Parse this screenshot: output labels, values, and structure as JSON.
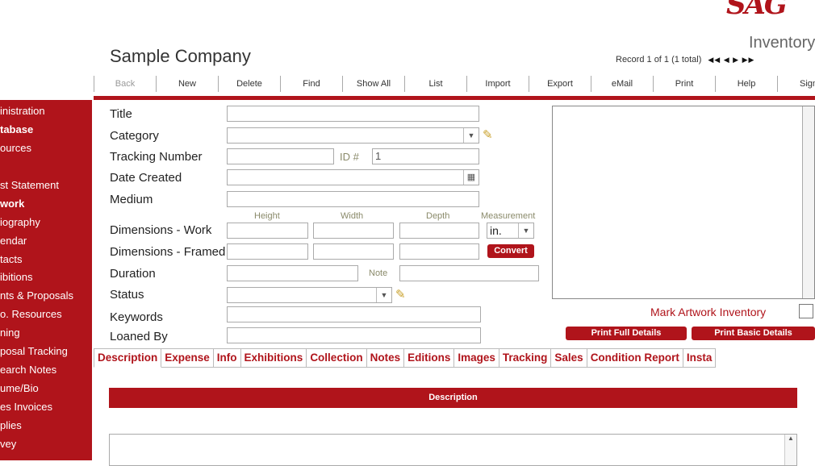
{
  "brand": {
    "logo_text": "SAG"
  },
  "header": {
    "company": "Sample Company",
    "module": "Inventory",
    "record_text": "Record 1 of 1 (1 total)",
    "record_nav": "◀◀ ◀ ▶ ▶▶"
  },
  "toolbar": [
    "Back",
    "New",
    "Delete",
    "Find",
    "Show All",
    "List",
    "Import",
    "Export",
    "eMail",
    "Print",
    "Help",
    "Sign"
  ],
  "sidebar": [
    {
      "label": "inistration",
      "bold": false
    },
    {
      "label": "tabase",
      "bold": true
    },
    {
      "label": "ources",
      "bold": false
    },
    {
      "label": "",
      "bold": false
    },
    {
      "label": "st Statement",
      "bold": false
    },
    {
      "label": "work",
      "bold": true
    },
    {
      "label": "iography",
      "bold": false
    },
    {
      "label": "endar",
      "bold": false
    },
    {
      "label": "tacts",
      "bold": false
    },
    {
      "label": "ibitions",
      "bold": false
    },
    {
      "label": "nts & Proposals",
      "bold": false
    },
    {
      "label": "o. Resources",
      "bold": false
    },
    {
      "label": "ning",
      "bold": false
    },
    {
      "label": "posal Tracking",
      "bold": false
    },
    {
      "label": "earch Notes",
      "bold": false
    },
    {
      "label": "ume/Bio",
      "bold": false
    },
    {
      "label": "es Invoices",
      "bold": false
    },
    {
      "label": "plies",
      "bold": false
    },
    {
      "label": "vey",
      "bold": false
    }
  ],
  "form": {
    "title_label": "Title",
    "category_label": "Category",
    "tracking_label": "Tracking Number",
    "id_label": "ID #",
    "id_value": "1",
    "date_label": "Date Created",
    "medium_label": "Medium",
    "dim_work_label": "Dimensions - Work",
    "dim_framed_label": "Dimensions - Framed",
    "height_label": "Height",
    "width_label": "Width",
    "depth_label": "Depth",
    "measurement_label": "Measurement",
    "measurement_value": "in.",
    "convert_label": "Convert",
    "duration_label": "Duration",
    "note_label": "Note",
    "status_label": "Status",
    "keywords_label": "Keywords",
    "loaned_label": "Loaned By"
  },
  "image_panel": {
    "mark_label": "Mark Artwork Inventory",
    "print_full": "Print Full Details",
    "print_basic": "Print Basic Details"
  },
  "tabs": [
    "Description",
    "Expense",
    "Info",
    "Exhibitions",
    "Collection",
    "Notes",
    "Editions",
    "Images",
    "Tracking",
    "Sales",
    "Condition Report",
    "Insta"
  ],
  "section": {
    "title": "Description"
  },
  "colors": {
    "accent": "#b0141b"
  }
}
